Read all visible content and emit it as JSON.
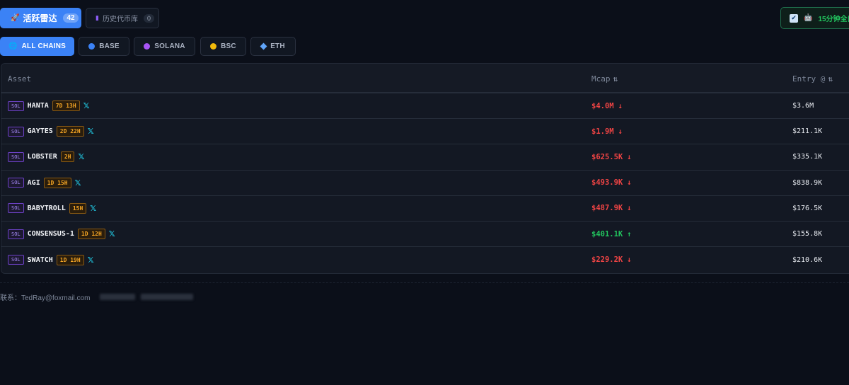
{
  "tabs": {
    "active": {
      "icon": "🚀",
      "label": "活跃雷达",
      "count": "42"
    },
    "history": {
      "icon": "▮",
      "label": "历史代币库",
      "count": "0"
    }
  },
  "toggle": {
    "checked": "✔",
    "icon": "🤖",
    "label": "15分钟全自"
  },
  "chains": [
    {
      "label": "ALL CHAINS",
      "icon": "globe-icon",
      "color": "#60a5fa"
    },
    {
      "label": "BASE",
      "icon": "base-dot-icon",
      "color": "#3b82f6"
    },
    {
      "label": "SOLANA",
      "icon": "solana-dot-icon",
      "color": "#a855f7"
    },
    {
      "label": "BSC",
      "icon": "bsc-dot-icon",
      "color": "#f0b90b"
    },
    {
      "label": "ETH",
      "icon": "eth-diamond-icon",
      "color": "#60a5fa"
    }
  ],
  "table": {
    "headers": {
      "asset": "Asset",
      "mcap": "Mcap",
      "entry": "Entry @",
      "sort_icon": "⇅"
    },
    "rows": [
      {
        "chain": "SOL",
        "symbol": "HANTA",
        "age": "7D 13H",
        "mcap": "$4.0M",
        "trend": "↓",
        "entry": "$3.6M"
      },
      {
        "chain": "SOL",
        "symbol": "GAYTES",
        "age": "2D 22H",
        "mcap": "$1.9M",
        "trend": "↓",
        "entry": "$211.1K"
      },
      {
        "chain": "SOL",
        "symbol": "LOBSTER",
        "age": "2H",
        "mcap": "$625.5K",
        "trend": "↓",
        "entry": "$335.1K"
      },
      {
        "chain": "SOL",
        "symbol": "AGI",
        "age": "1D 15H",
        "mcap": "$493.9K",
        "trend": "↓",
        "entry": "$838.9K"
      },
      {
        "chain": "SOL",
        "symbol": "BABYTROLL",
        "age": "15H",
        "mcap": "$487.9K",
        "trend": "↓",
        "entry": "$176.5K"
      },
      {
        "chain": "SOL",
        "symbol": "CONSENSUS-1",
        "age": "1D 12H",
        "mcap": "$401.1K",
        "trend": "↑",
        "entry": "$155.8K"
      },
      {
        "chain": "SOL",
        "symbol": "SWATCH",
        "age": "1D 19H",
        "mcap": "$229.2K",
        "trend": "↓",
        "entry": "$210.6K"
      }
    ],
    "x_icon": "𝕏"
  },
  "footer": {
    "contact": "联系：TedRay@foxmail.com"
  },
  "colors": {
    "accent": "#3b82f6",
    "down": "#ef4444",
    "up": "#22c55e",
    "background": "#0b0f19"
  }
}
